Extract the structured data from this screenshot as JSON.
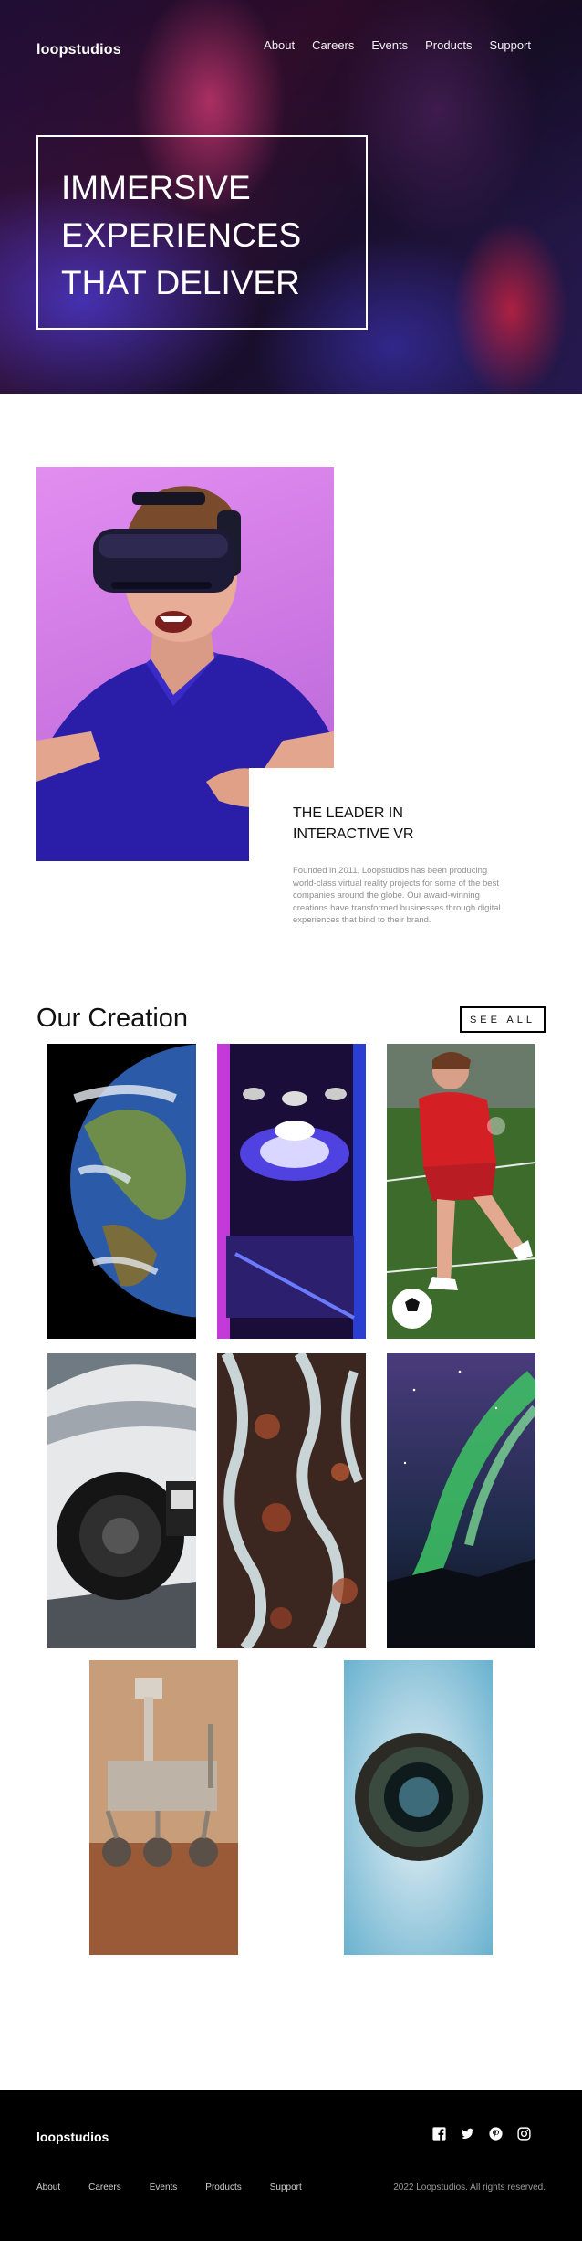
{
  "brand": {
    "logo": "loopstudios"
  },
  "nav": {
    "items": [
      "About",
      "Careers",
      "Events",
      "Products",
      "Support"
    ]
  },
  "hero": {
    "title": "Immersive experiences that deliver"
  },
  "about": {
    "heading": "The leader in interactive VR",
    "body": "Founded in 2011, Loopstudios has been producing world-class virtual reality projects for some of the best companies around the globe. Our award-winning creations have transformed businesses through digital experiences that bind to their brand."
  },
  "creations": {
    "title": "Our Creation",
    "see_all_label": "See All",
    "tiles": [
      "earth-tile",
      "arcade-tile",
      "soccer-tile",
      "race-car-tile",
      "pattern-tile",
      "aurora-tile",
      "rover-tile",
      "fisheye-tile"
    ]
  },
  "footer": {
    "logo": "loopstudios",
    "links": [
      "About",
      "Careers",
      "Events",
      "Products",
      "Support"
    ],
    "copyright": "2022 Loopstudios. All rights reserved.",
    "social_icons": [
      "facebook-icon",
      "twitter-icon",
      "pinterest-icon",
      "instagram-icon"
    ]
  }
}
